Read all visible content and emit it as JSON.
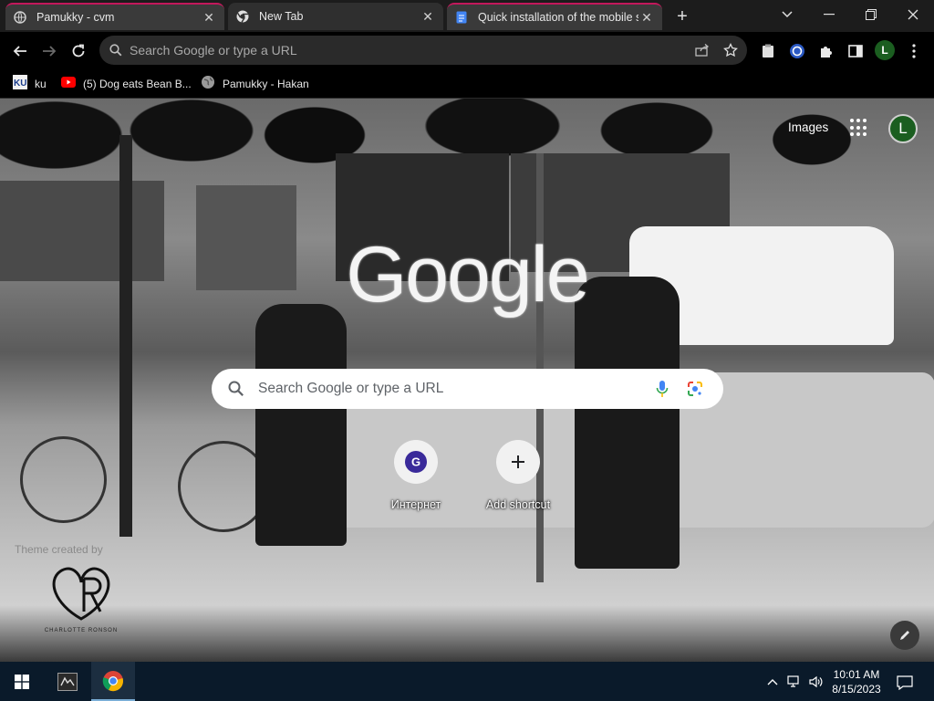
{
  "tabs": [
    {
      "title": "Pamukky - cvm",
      "active": false,
      "icon": "globe-icon"
    },
    {
      "title": "New Tab",
      "active": true,
      "icon": "chrome-icon"
    },
    {
      "title": "Quick installation of the mobile s",
      "active": false,
      "icon": "doc-icon"
    }
  ],
  "toolbar": {
    "omnibox_placeholder": "Search Google or type a URL",
    "profile_initial": "L"
  },
  "bookmarks": [
    {
      "label": "ku",
      "icon": "ku-icon"
    },
    {
      "label": "(5) Dog eats Bean B...",
      "icon": "youtube-icon"
    },
    {
      "label": "Pamukky - Hakan",
      "icon": "globe-icon"
    }
  ],
  "ntp": {
    "images_link": "Images",
    "account_initial": "L",
    "logo": "Google",
    "search_placeholder": "Search Google or type a URL",
    "shortcuts": [
      {
        "label": "Интернет",
        "icon_letter": "G"
      },
      {
        "label": "Add shortcut",
        "icon_letter": "+"
      }
    ],
    "theme_credit": "Theme created by",
    "theme_logo_text": "CHARLOTTE RONSON",
    "theme_logo_monogram": "CR"
  },
  "taskbar": {
    "time": "10:01 AM",
    "date": "8/15/2023"
  },
  "colors": {
    "tab_accent": "#c2185b",
    "profile": "#1b5e20",
    "taskbar": "#0a1a2a"
  }
}
